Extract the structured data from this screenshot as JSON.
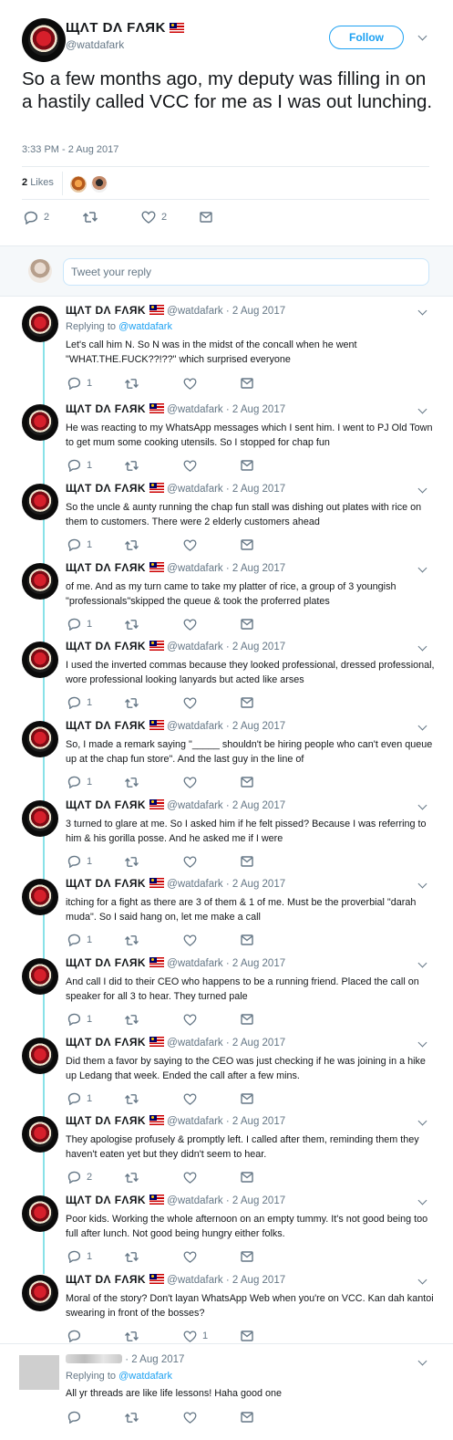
{
  "main_tweet": {
    "display_name": "ЩΛT DΛ FΛЯK",
    "handle": "@watdafark",
    "follow_label": "Follow",
    "text": "So a few months ago, my deputy was filling in on a hastily called VCC for me as I was out lunching.",
    "timestamp": "3:33 PM - 2 Aug 2017",
    "likes_count": "2",
    "likes_label": "Likes",
    "reply_count": "2",
    "like_count": "2"
  },
  "reply_box": {
    "placeholder": "Tweet your reply"
  },
  "thread": [
    {
      "name": "ЩΛT DΛ FΛЯK",
      "handle": "@watdafark",
      "date": "· 2 Aug 2017",
      "replying_prefix": "Replying to",
      "replying_to": "@watdafark",
      "text": "Let's call him N. So N was in the midst of the concall when he went \"WHAT.THE.FUCK??!??\" which surprised everyone",
      "replies": "1",
      "likes": ""
    },
    {
      "name": "ЩΛT DΛ FΛЯK",
      "handle": "@watdafark",
      "date": "· 2 Aug 2017",
      "text": "He was reacting to my WhatsApp messages which I sent him. I went to PJ Old Town to get mum some cooking utensils. So I stopped for chap fun",
      "replies": "1",
      "likes": ""
    },
    {
      "name": "ЩΛT DΛ FΛЯK",
      "handle": "@watdafark",
      "date": "· 2 Aug 2017",
      "text": "So the uncle & aunty running the chap fun stall was dishing out plates with rice on them to customers. There were 2 elderly customers ahead",
      "replies": "1",
      "likes": ""
    },
    {
      "name": "ЩΛT DΛ FΛЯK",
      "handle": "@watdafark",
      "date": "· 2 Aug 2017",
      "text": "of me. And as my turn came to take my platter of rice, a group of 3 youngish \"professionals\"skipped the queue & took the proferred plates",
      "replies": "1",
      "likes": ""
    },
    {
      "name": "ЩΛT DΛ FΛЯK",
      "handle": "@watdafark",
      "date": "· 2 Aug 2017",
      "text": "I used the inverted commas because they looked professional, dressed professional, wore professional looking lanyards but acted like arses",
      "replies": "1",
      "likes": ""
    },
    {
      "name": "ЩΛT DΛ FΛЯK",
      "handle": "@watdafark",
      "date": "· 2 Aug 2017",
      "text": "So, I made a remark saying \"_____ shouldn't be hiring people who can't even queue up at the chap fun store\". And the last guy in the line of",
      "replies": "1",
      "likes": ""
    },
    {
      "name": "ЩΛT DΛ FΛЯK",
      "handle": "@watdafark",
      "date": "· 2 Aug 2017",
      "text": "3 turned to glare at me. So I asked him if he felt pissed? Because I was referring to him & his gorilla posse. And he asked me if I were",
      "replies": "1",
      "likes": ""
    },
    {
      "name": "ЩΛT DΛ FΛЯK",
      "handle": "@watdafark",
      "date": "· 2 Aug 2017",
      "text": "itching for a fight as there are 3 of them & 1 of me. Must be the proverbial \"darah muda\". So I said hang on, let me make a call",
      "replies": "1",
      "likes": ""
    },
    {
      "name": "ЩΛT DΛ FΛЯK",
      "handle": "@watdafark",
      "date": "· 2 Aug 2017",
      "text": "And call I did to their CEO who happens to be a running friend. Placed the call on speaker for all 3 to hear. They turned pale",
      "replies": "1",
      "likes": ""
    },
    {
      "name": "ЩΛT DΛ FΛЯK",
      "handle": "@watdafark",
      "date": "· 2 Aug 2017",
      "text": "Did them a favor by saying to the CEO was just checking if he was joining in a hike up Ledang that week. Ended the call after a few mins.",
      "replies": "1",
      "likes": ""
    },
    {
      "name": "ЩΛT DΛ FΛЯK",
      "handle": "@watdafark",
      "date": "· 2 Aug 2017",
      "text": "They apologise profusely & promptly left. I called after them, reminding them they haven't eaten yet but they didn't seem to hear.",
      "replies": "2",
      "likes": ""
    },
    {
      "name": "ЩΛT DΛ FΛЯK",
      "handle": "@watdafark",
      "date": "· 2 Aug 2017",
      "text": "Poor kids. Working the whole afternoon on an empty tummy. It's not good being too full after lunch. Not good being hungry either folks.",
      "replies": "1",
      "likes": ""
    },
    {
      "name": "ЩΛT DΛ FΛЯK",
      "handle": "@watdafark",
      "date": "· 2 Aug 2017",
      "text": "Moral of the story? Don't layan WhatsApp Web when you're on VCC. Kan dah kantoi swearing in front of the bosses?",
      "replies": "",
      "likes": "1"
    }
  ],
  "other_reply": {
    "date": "· 2 Aug 2017",
    "replying_prefix": "Replying to",
    "replying_to": "@watdafark",
    "text": "All yr threads are like life lessons! Haha good one"
  },
  "colors": {
    "accent": "#1da1f2",
    "thread_line": "#89e2e8",
    "muted": "#657786",
    "text": "#14171a"
  },
  "icons": [
    "reply-icon",
    "retweet-icon",
    "heart-icon",
    "message-icon",
    "chevron-down-icon",
    "malaysia-flag-icon"
  ]
}
